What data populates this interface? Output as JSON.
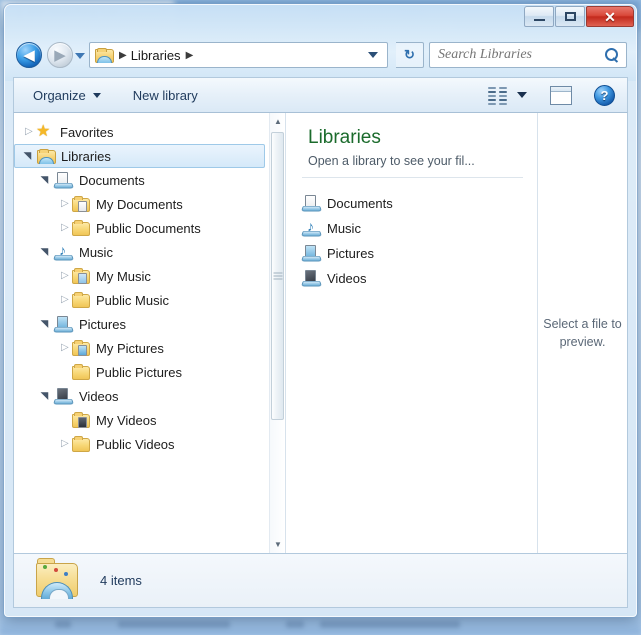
{
  "backdrop": {
    "tab_title": "...g and Searching bas...",
    "tab_close": "×"
  },
  "window": {
    "controls": {
      "minimize": "Minimize",
      "maximize": "Maximize",
      "close": "✕"
    }
  },
  "navigation": {
    "back_label": "Back",
    "back_glyph": "◀",
    "forward_label": "Forward",
    "forward_glyph": "▶",
    "recent_label": "Recent pages",
    "refresh_glyph": "↻",
    "refresh_label": "Refresh"
  },
  "address": {
    "icon": "libraries-icon",
    "separator": "▶",
    "crumb": "Libraries",
    "trailing_separator": "▶",
    "dropdown_label": "Previous locations"
  },
  "search": {
    "placeholder": "Search Libraries",
    "value": "",
    "icon": "search-icon"
  },
  "command_bar": {
    "organize": "Organize",
    "new_library": "New library",
    "change_view_label": "Change your view",
    "preview_pane_label": "Show the preview pane",
    "help_label": "Get help",
    "help_glyph": "?"
  },
  "nav_pane": {
    "items": [
      {
        "label": "Favorites",
        "level": 0,
        "icon": "star-icon",
        "state": "collapsed",
        "selected": false
      },
      {
        "label": "Libraries",
        "level": 0,
        "icon": "libraries-icon",
        "state": "expanded",
        "selected": true
      },
      {
        "label": "Documents",
        "level": 1,
        "icon": "documents-library-icon",
        "state": "expanded",
        "selected": false
      },
      {
        "label": "My Documents",
        "level": 2,
        "icon": "my-documents-folder-icon",
        "state": "collapsed",
        "selected": false
      },
      {
        "label": "Public Documents",
        "level": 2,
        "icon": "folder-icon",
        "state": "collapsed",
        "selected": false
      },
      {
        "label": "Music",
        "level": 1,
        "icon": "music-library-icon",
        "state": "expanded",
        "selected": false
      },
      {
        "label": "My Music",
        "level": 2,
        "icon": "my-music-folder-icon",
        "state": "collapsed",
        "selected": false
      },
      {
        "label": "Public Music",
        "level": 2,
        "icon": "folder-icon",
        "state": "collapsed",
        "selected": false
      },
      {
        "label": "Pictures",
        "level": 1,
        "icon": "pictures-library-icon",
        "state": "expanded",
        "selected": false
      },
      {
        "label": "My Pictures",
        "level": 2,
        "icon": "my-pictures-folder-icon",
        "state": "collapsed",
        "selected": false
      },
      {
        "label": "Public Pictures",
        "level": 2,
        "icon": "folder-icon",
        "state": "leaf",
        "selected": false
      },
      {
        "label": "Videos",
        "level": 1,
        "icon": "videos-library-icon",
        "state": "expanded",
        "selected": false
      },
      {
        "label": "My Videos",
        "level": 2,
        "icon": "my-videos-folder-icon",
        "state": "leaf",
        "selected": false
      },
      {
        "label": "Public Videos",
        "level": 2,
        "icon": "folder-icon",
        "state": "collapsed",
        "selected": false
      }
    ],
    "scrollbar": {
      "up_glyph": "▲",
      "down_glyph": "▼"
    }
  },
  "content": {
    "title": "Libraries",
    "title_color": "#1b6b2c",
    "subtitle": "Open a library to see your fil...",
    "items": [
      {
        "label": "Documents",
        "icon": "documents-library-icon"
      },
      {
        "label": "Music",
        "icon": "music-library-icon"
      },
      {
        "label": "Pictures",
        "icon": "pictures-library-icon"
      },
      {
        "label": "Videos",
        "icon": "videos-library-icon"
      }
    ]
  },
  "preview_pane": {
    "message": "Select a file to preview."
  },
  "status_bar": {
    "icon": "libraries-folder-icon",
    "text": "4 items"
  }
}
